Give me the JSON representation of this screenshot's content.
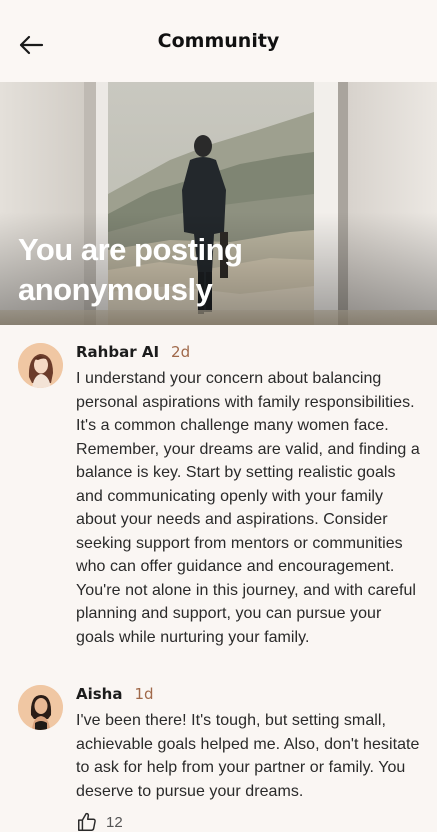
{
  "header": {
    "title": "Community",
    "back_icon": "arrow-left-icon"
  },
  "hero": {
    "overlay_text": "You are posting anonymously"
  },
  "comments": [
    {
      "author": "Rahbar AI",
      "time": "2d",
      "text": "I understand your concern about balancing personal aspirations with family responsibilities. It's a common challenge many women face. Remember, your dreams are valid, and finding a balance is key. Start by setting realistic goals and communicating openly with your family about your needs and aspirations. Consider seeking support from mentors or communities who can offer guidance and encouragement. You're not alone in this journey, and with careful planning and support, you can pursue your goals while nurturing your family."
    },
    {
      "author": "Aisha",
      "time": "1d",
      "text": "I've been there! It's tough, but setting small, achievable goals helped me. Also, don't hesitate to ask for help from your partner or family. You deserve to pursue your dreams.",
      "likes": "12"
    }
  ],
  "colors": {
    "background": "#faf6f3",
    "timestamp": "#a0694a",
    "avatar_bg": "#f0c7a3"
  }
}
